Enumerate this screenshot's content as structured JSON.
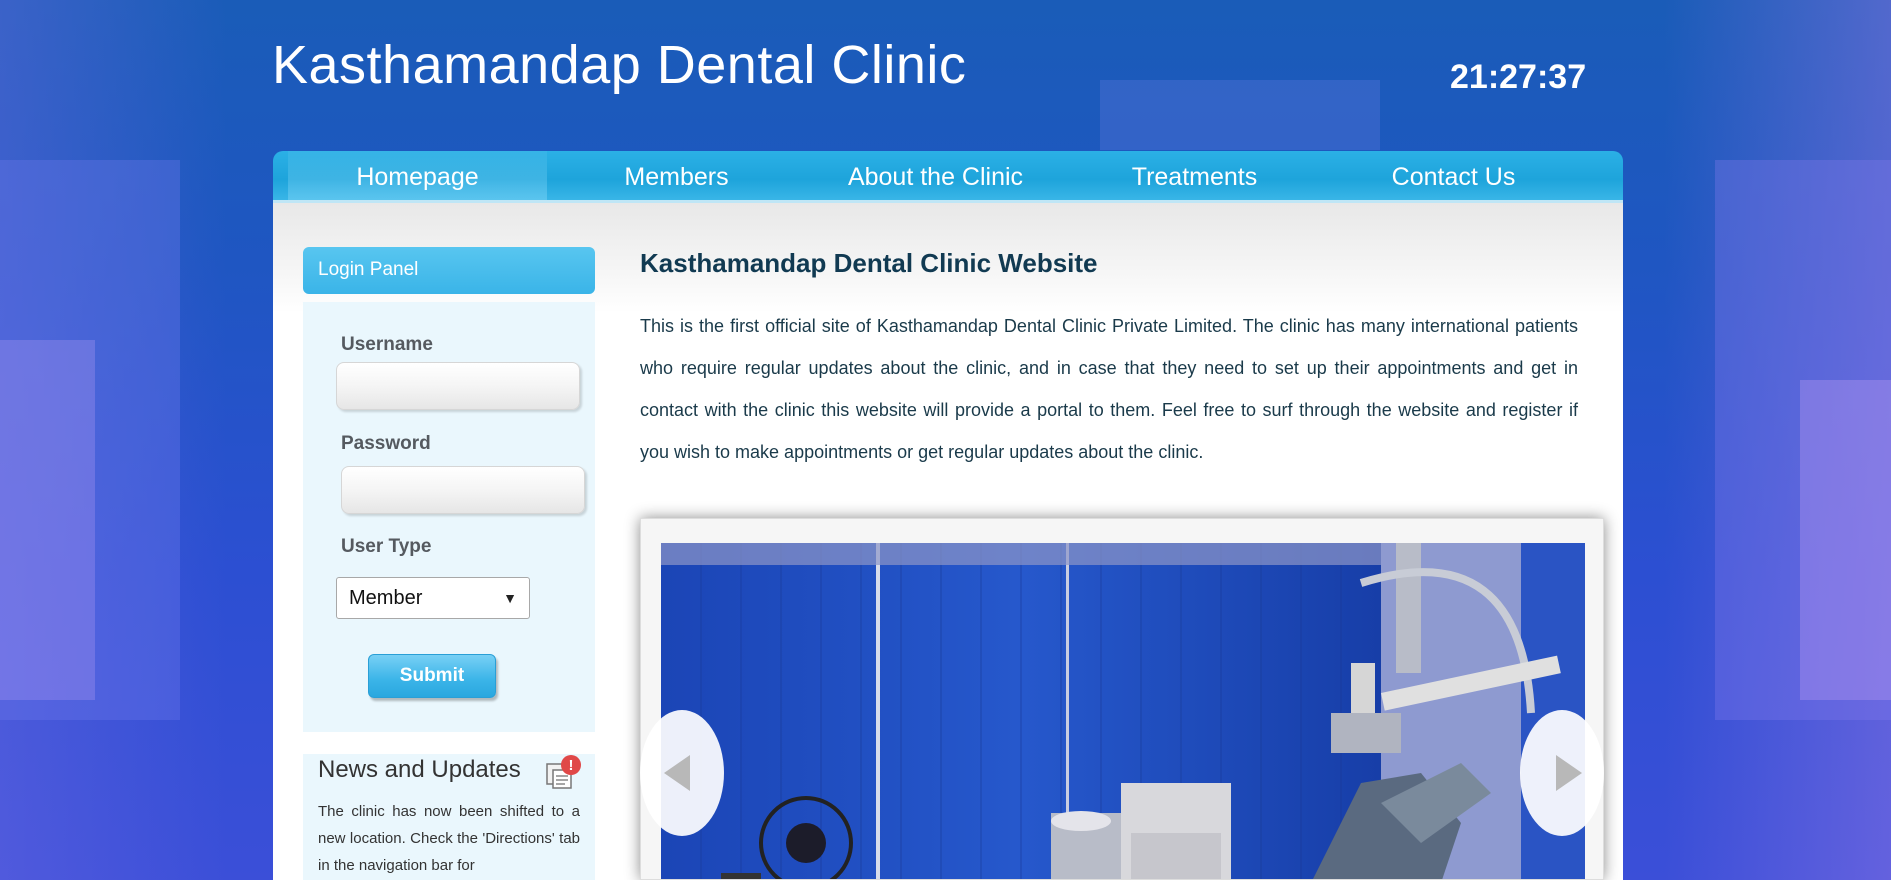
{
  "header": {
    "title": "Kasthamandap Dental Clinic",
    "clock": "21:27:37"
  },
  "nav": {
    "items": [
      {
        "label": "Homepage",
        "active": true
      },
      {
        "label": "Members",
        "active": false
      },
      {
        "label": "About the Clinic",
        "active": false
      },
      {
        "label": "Treatments",
        "active": false
      },
      {
        "label": "Contact Us",
        "active": false
      }
    ]
  },
  "login": {
    "title": "Login Panel",
    "username_label": "Username",
    "username_value": "",
    "password_label": "Password",
    "password_value": "",
    "user_type_label": "User Type",
    "user_type_selected": "Member",
    "submit_label": "Submit"
  },
  "news": {
    "title": "News and Updates",
    "icon": "news-alert-icon",
    "text": "The clinic has now been shifted to a new location. Check the 'Directions' tab in the navigation bar for"
  },
  "main": {
    "title": "Kasthamandap Dental Clinic Website",
    "intro": "This is the first official site of Kasthamandap Dental Clinic Private Limited. The clinic has many international patients who require regular updates about the clinic, and in case that they need to set up their appointments and get in contact with the clinic this website will provide a portal to them. Feel free to surf through the website and register if you wish to make appointments or get regular updates about the clinic."
  },
  "slider": {
    "prev_icon": "triangle-left-icon",
    "next_icon": "triangle-right-icon"
  },
  "colors": {
    "nav_bar": "#1ea4db",
    "login_header": "#3ab4e8",
    "panel_bg": "#eaf7fd",
    "title_text": "#113a52"
  }
}
